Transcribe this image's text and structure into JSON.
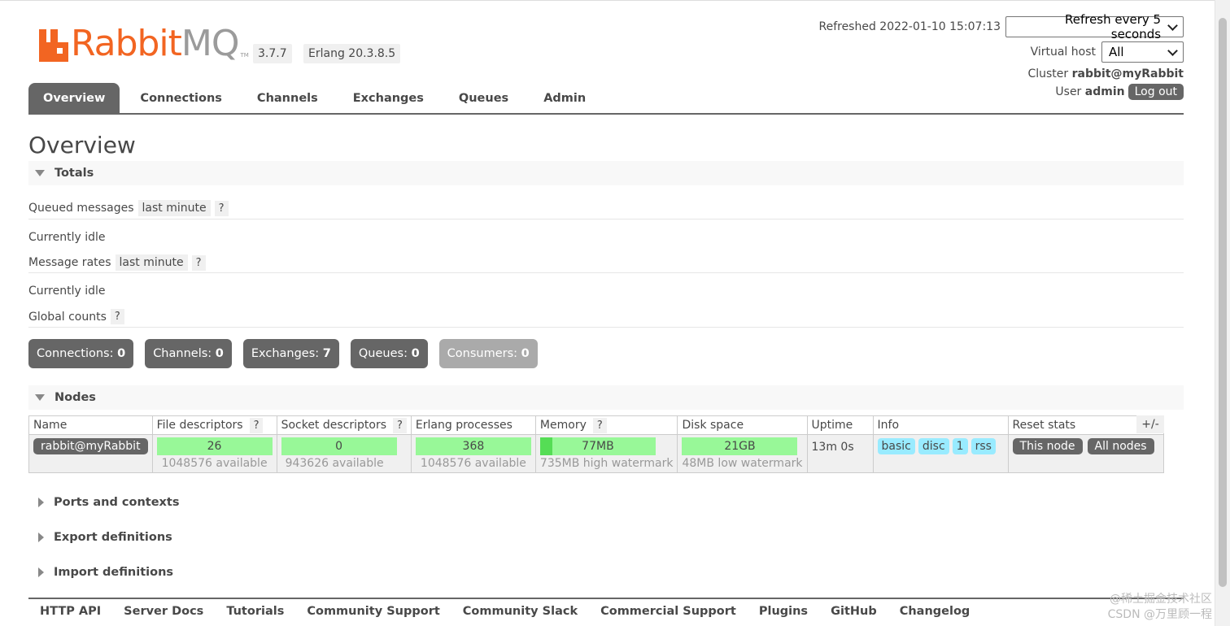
{
  "header": {
    "logo": {
      "word1": "Rabbit",
      "word2": "MQ",
      "tm": "TM"
    },
    "version": "3.7.7",
    "erlang": "Erlang 20.3.8.5",
    "refreshed_label": "Refreshed 2022-01-10 15:07:13",
    "refresh_select": "Refresh every 5 seconds",
    "vhost_label": "Virtual host",
    "vhost_select": "All",
    "cluster_label": "Cluster",
    "cluster_value": "rabbit@myRabbit",
    "user_label": "User",
    "user_value": "admin",
    "logout": "Log out"
  },
  "tabs": [
    "Overview",
    "Connections",
    "Channels",
    "Exchanges",
    "Queues",
    "Admin"
  ],
  "page_title": "Overview",
  "totals": {
    "section": "Totals",
    "queued_label": "Queued messages",
    "queued_period": "last minute",
    "help": "?",
    "queued_status": "Currently idle",
    "rates_label": "Message rates",
    "rates_period": "last minute",
    "rates_status": "Currently idle",
    "global_label": "Global counts"
  },
  "counts": [
    {
      "label": "Connections:",
      "value": "0"
    },
    {
      "label": "Channels:",
      "value": "0"
    },
    {
      "label": "Exchanges:",
      "value": "7"
    },
    {
      "label": "Queues:",
      "value": "0"
    },
    {
      "label": "Consumers:",
      "value": "0"
    }
  ],
  "nodes": {
    "section": "Nodes",
    "toggle_columns": "+/-",
    "columns": [
      "Name",
      "File descriptors",
      "Socket descriptors",
      "Erlang processes",
      "Memory",
      "Disk space",
      "Uptime",
      "Info",
      "Reset stats"
    ],
    "row": {
      "name": "rabbit@myRabbit",
      "fd": "26",
      "fd_sub": "1048576 available",
      "sock": "0",
      "sock_sub": "943626 available",
      "erl": "368",
      "erl_sub": "1048576 available",
      "mem": "77MB",
      "mem_sub": "735MB high watermark",
      "mem_fraction": 0.105,
      "disk": "21GB",
      "disk_sub": "48MB low watermark",
      "uptime": "13m 0s",
      "info": [
        "basic",
        "disc",
        "1",
        "rss"
      ],
      "reset": [
        "This node",
        "All nodes"
      ]
    }
  },
  "collapsed_sections": [
    "Ports and contexts",
    "Export definitions",
    "Import definitions"
  ],
  "footer": [
    "HTTP API",
    "Server Docs",
    "Tutorials",
    "Community Support",
    "Community Slack",
    "Commercial Support",
    "Plugins",
    "GitHub",
    "Changelog"
  ],
  "watermark": {
    "line1": "@稀土掘金技术社区",
    "line2": "CSDN @万里顾一程"
  },
  "colors": {
    "brand": "#f26522",
    "tab_active": "#666666",
    "bar_green": "#98f898",
    "info_tag": "#99ebff"
  }
}
